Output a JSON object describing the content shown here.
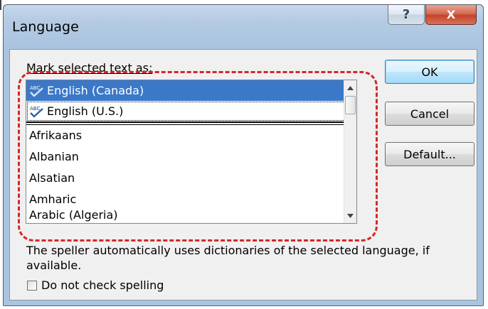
{
  "window": {
    "title": "Language",
    "help_label": "?",
    "close_label": "X"
  },
  "dialog": {
    "mark_label": "Mark selected text as:",
    "languages": [
      {
        "label": "English (Canada)",
        "spellcheck_icon": "abc-check-icon",
        "selected": true
      },
      {
        "label": "English (U.S.)",
        "spellcheck_icon": "abc-check-icon",
        "selected": false
      },
      {
        "label": "Afrikaans"
      },
      {
        "label": "Albanian"
      },
      {
        "label": "Alsatian"
      },
      {
        "label": "Amharic"
      },
      {
        "label": "Arabic (Algeria)"
      }
    ],
    "buttons": {
      "ok": "OK",
      "cancel": "Cancel",
      "default": "Default..."
    },
    "info_text": "The speller automatically uses dictionaries of the selected language, if available.",
    "checkbox": {
      "label": "Do not check spelling",
      "checked": false
    }
  },
  "colors": {
    "selection": "#3b78c8",
    "highlight_ring": "#d8262a",
    "close_button": "#c5432a"
  }
}
